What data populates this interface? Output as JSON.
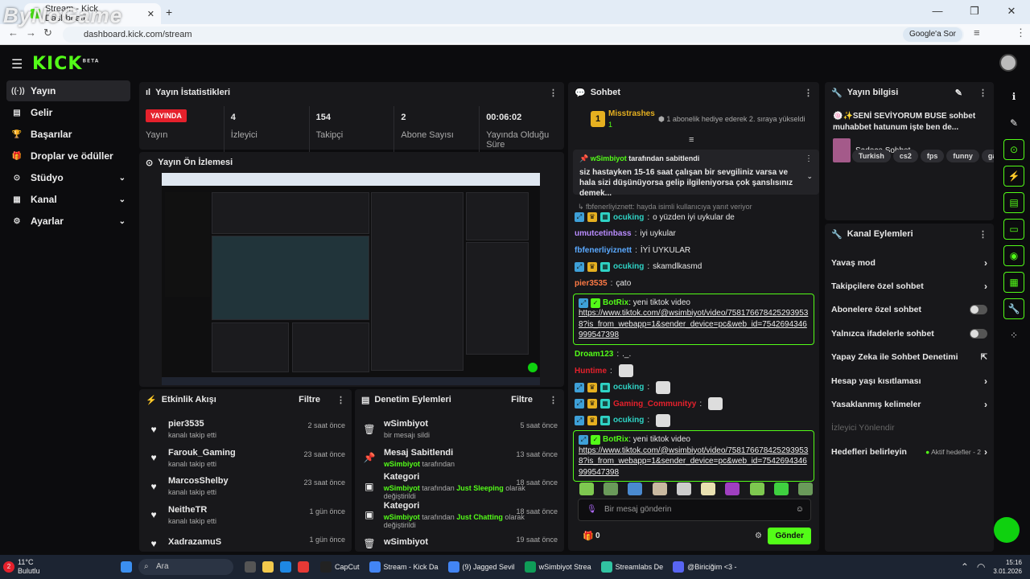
{
  "browser": {
    "tab_title": "Stream - Kick Dashboard",
    "url": "dashboard.kick.com/stream",
    "google_sor": "Google'a Sor",
    "watermark": "ByNoGame"
  },
  "topbar": {
    "logo": "KICK",
    "logo_sup": "BETA"
  },
  "sidebar": {
    "items": [
      {
        "label": "Yayın",
        "icon": "broadcast-icon",
        "glyph": "((·))"
      },
      {
        "label": "Gelir",
        "icon": "revenue-icon",
        "glyph": "▤"
      },
      {
        "label": "Başarılar",
        "icon": "trophy-icon",
        "glyph": "🏆"
      },
      {
        "label": "Droplar ve ödüller",
        "icon": "gift-icon",
        "glyph": "🎁"
      },
      {
        "label": "Stüdyo",
        "icon": "studio-icon",
        "glyph": "⊙"
      },
      {
        "label": "Kanal",
        "icon": "channel-icon",
        "glyph": "▦"
      },
      {
        "label": "Ayarlar",
        "icon": "settings-icon",
        "glyph": "⚙"
      }
    ]
  },
  "stats": {
    "title": "Yayın İstatistikleri",
    "live_badge": "YAYINDA",
    "items": [
      {
        "value": "",
        "label": "Yayın"
      },
      {
        "value": "4",
        "label": "İzleyici"
      },
      {
        "value": "154",
        "label": "Takipçi"
      },
      {
        "value": "2",
        "label": "Abone Sayısı"
      },
      {
        "value": "00:06:02",
        "label": "Yayında Olduğu Süre"
      }
    ]
  },
  "preview": {
    "title": "Yayın Ön İzlemesi"
  },
  "activity": {
    "title": "Etkinlik Akışı",
    "filter": "Filtre",
    "items": [
      {
        "name": "pier3535",
        "desc": "kanalı takip etti",
        "time": "2 saat önce"
      },
      {
        "name": "Farouk_Gaming",
        "desc": "kanalı takip etti",
        "time": "23 saat önce"
      },
      {
        "name": "MarcosShelby",
        "desc": "kanalı takip etti",
        "time": "23 saat önce"
      },
      {
        "name": "NeitheTR",
        "desc": "kanalı takip etti",
        "time": "1 gün önce"
      },
      {
        "name": "XadrazamuS",
        "desc": "",
        "time": "1 gün önce"
      }
    ]
  },
  "moderation": {
    "title": "Denetim Eylemleri",
    "filter": "Filtre",
    "items": [
      {
        "title": "wSimbiyot",
        "user": "",
        "desc": "bir mesajı sildi",
        "mid": "",
        "end": "",
        "time": "5 saat önce"
      },
      {
        "title": "Mesaj Sabitlendi",
        "user": "wSimbiyot",
        "desc": " tarafından",
        "mid": "",
        "end": "",
        "time": "13 saat önce"
      },
      {
        "title": "Kategori",
        "user": "wSimbiyot",
        "desc": " tarafından ",
        "mid": "Just Sleeping",
        "end": " olarak değiştirildi",
        "time": "18 saat önce"
      },
      {
        "title": "Kategori",
        "user": "wSimbiyot",
        "desc": " tarafından ",
        "mid": "Just Chatting",
        "end": " olarak değiştirildi",
        "time": "18 saat önce"
      },
      {
        "title": "wSimbiyot",
        "user": "",
        "desc": "",
        "mid": "",
        "end": "",
        "time": "19 saat önce"
      }
    ]
  },
  "chat": {
    "title": "Sohbet",
    "top_gifter": "Misstrashes",
    "top_gifter_count": "1",
    "gift_notice": "1 abonelik hediye ederek 2. sıraya yükseldi",
    "pinned_by": "wSimbiyot",
    "pinned_by_suffix": " tarafından sabitlendi",
    "pinned_text": "siz hastayken 15-16 saat çalışan bir sevgiliniz varsa ve hala sizi düşünüyorsa gelip ilgileniyorsa çok şanslısınız demek...",
    "reply_notice": "fbfenerliyiznett: hayda isimli kullanıcıya yanıt veriyor",
    "messages": [
      {
        "user": "ocuking",
        "color": "#2fd3c5",
        "badges": true,
        "text": "o yüzden iyi uykular de"
      },
      {
        "user": "umutcetinbass",
        "color": "#b98cff",
        "badges": false,
        "text": "iyi uykular"
      },
      {
        "user": "fbfenerliyiznett",
        "color": "#5aa9ff",
        "badges": false,
        "text": "İYİ UYKULAR"
      },
      {
        "user": "ocuking",
        "color": "#2fd3c5",
        "badges": true,
        "text": "skamdlkasmd"
      },
      {
        "user": "pier3535",
        "color": "#ff7a45",
        "badges": false,
        "text": "çato"
      }
    ],
    "bot1": {
      "user": "BotRix",
      "text": "yeni tiktok video",
      "link": "https://www.tiktok.com/@wsimbiyot/video/7581766784252939538?is_from_webapp=1&sender_device=pc&web_id=7542694346999547398"
    },
    "messages2": [
      {
        "user": "Droam123",
        "color": "#53fc18",
        "badges": false,
        "text": "._."
      },
      {
        "user": "Huntime",
        "color": "#e5212c",
        "badges": false,
        "text": ""
      },
      {
        "user": "ocuking",
        "color": "#2fd3c5",
        "badges": true,
        "text": ""
      },
      {
        "user": "Gaming_Communityy",
        "color": "#e5212c",
        "badges": true,
        "text": ""
      },
      {
        "user": "ocuking",
        "color": "#2fd3c5",
        "badges": true,
        "text": ""
      }
    ],
    "bot2": {
      "user": "BotRix",
      "text": "yeni tiktok video",
      "link": "https://www.tiktok.com/@wsimbiyot/video/7581766784252939538?is_from_webapp=1&sender_device=pc&web_id=7542694346999547398"
    },
    "input_placeholder": "Bir mesaj gönderin",
    "points": "0",
    "send": "Gönder"
  },
  "stream_info": {
    "title": "Yayın bilgisi",
    "stream_title": "SENİ SEVİYORUM BUSE sohbet muhabbet hatunum işte ben de...",
    "category": "Sadece Sohbet",
    "tags": [
      "Turkish",
      "cs2",
      "fps",
      "funny",
      "gam"
    ]
  },
  "channel_actions": {
    "title": "Kanal Eylemleri",
    "items": [
      {
        "label": "Yavaş mod",
        "ctrl": "chevron"
      },
      {
        "label": "Takipçilere özel sohbet",
        "ctrl": "chevron"
      },
      {
        "label": "Abonelere özel sohbet",
        "ctrl": "toggle"
      },
      {
        "label": "Yalnızca ifadelerle sohbet",
        "ctrl": "toggle"
      },
      {
        "label": "Yapay Zeka ile Sohbet Denetimi",
        "ctrl": "external"
      },
      {
        "label": "Hesap yaşı kısıtlaması",
        "ctrl": "chevron"
      },
      {
        "label": "Yasaklanmış kelimeler",
        "ctrl": "chevron"
      }
    ],
    "section": "İzleyici Yönlendir",
    "goals": "Hedefleri belirleyin",
    "goals_active": "Aktif hedefler - 2"
  },
  "taskbar": {
    "weather_temp": "11°C",
    "weather_desc": "Bulutlu",
    "search": "Ara",
    "apps": [
      {
        "label": "CapCut",
        "color": "#222"
      },
      {
        "label": "Stream - Kick Da",
        "color": "#4285f4"
      },
      {
        "label": "(9) Jagged Sevil",
        "color": "#4285f4"
      },
      {
        "label": "wSimbiyot Strea",
        "color": "#0f9d58"
      },
      {
        "label": "Streamlabs De",
        "color": "#31c3a2"
      },
      {
        "label": "@Biriciğim <3 -",
        "color": "#5865f2"
      }
    ],
    "time": "15:16",
    "date": "3.01.2026",
    "notif_count": "2"
  }
}
